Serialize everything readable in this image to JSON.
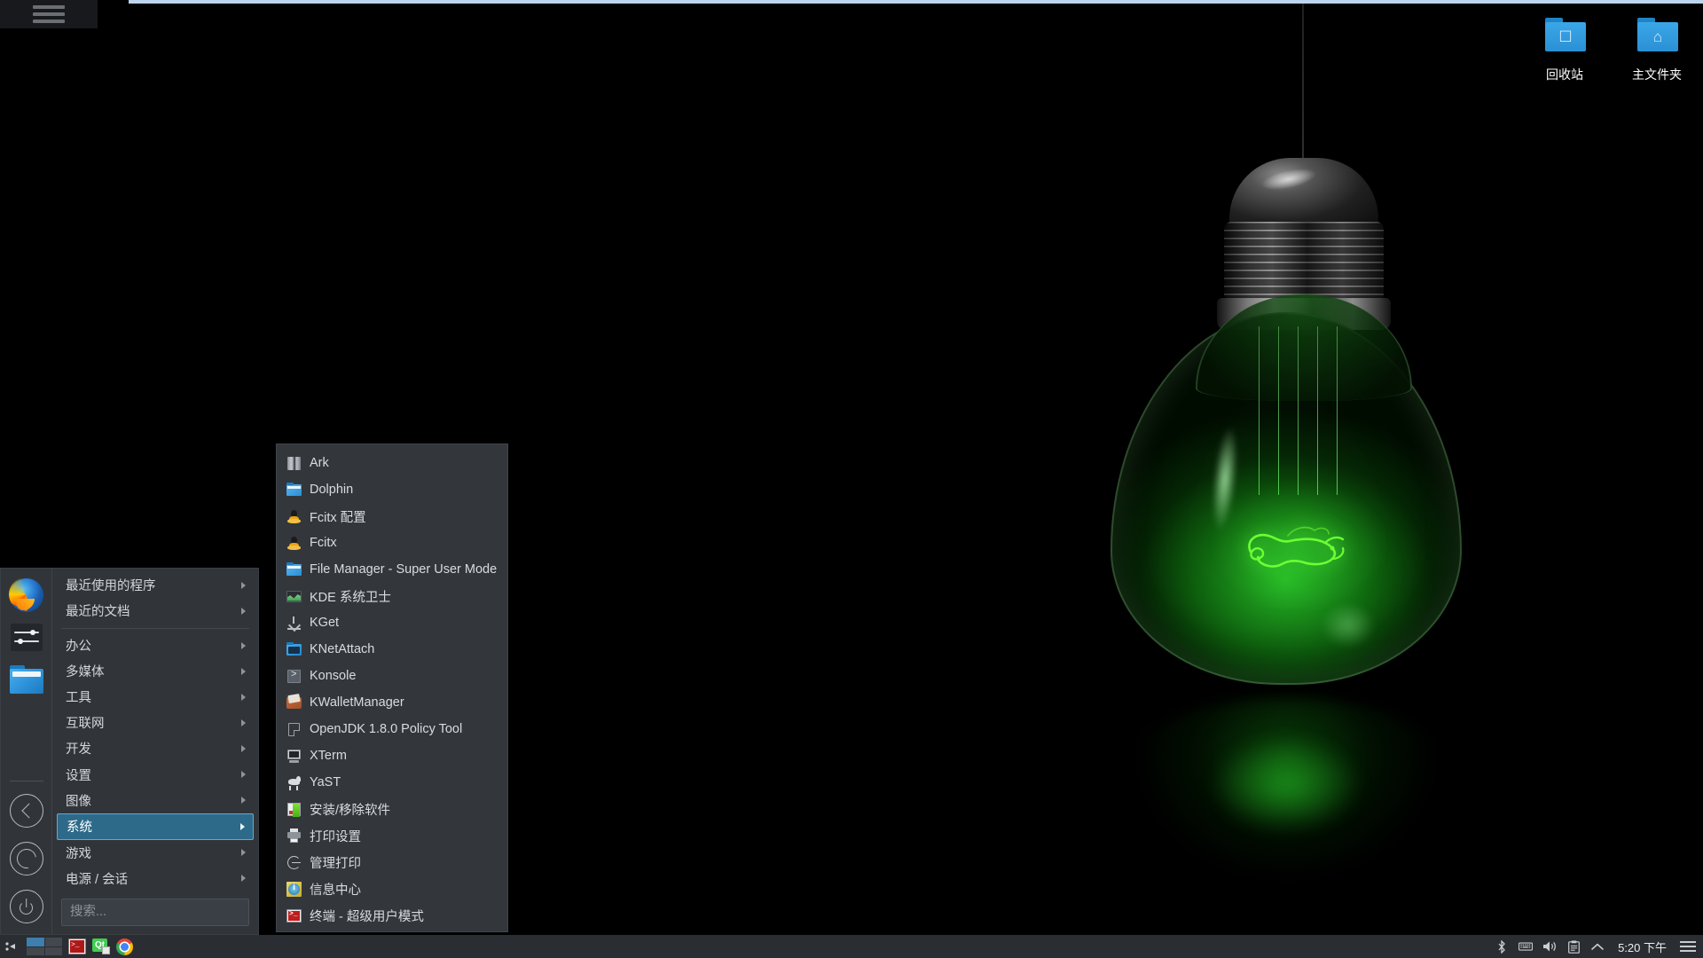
{
  "desktop": {
    "wallpaper_name": "openSUSE green light bulb",
    "icons": [
      {
        "label": "回收站",
        "icon": "trash-folder-icon",
        "glyph": "☐"
      },
      {
        "label": "主文件夹",
        "icon": "home-folder-icon",
        "glyph": "⌂"
      }
    ]
  },
  "topbar": {
    "hamburger_icon": "hamburger-menu-icon",
    "accent_color": "#bcd4ee"
  },
  "kmenu": {
    "side_icons": [
      {
        "name": "firefox-icon"
      },
      {
        "name": "settings-sliders-icon"
      },
      {
        "name": "file-manager-folder-icon"
      }
    ],
    "side_buttons": [
      {
        "name": "back-button",
        "icon": "chevron-left-circle-icon"
      },
      {
        "name": "restart-button",
        "icon": "refresh-circle-icon"
      },
      {
        "name": "power-button",
        "icon": "power-circle-icon"
      }
    ],
    "top_items": [
      {
        "label": "最近使用的程序",
        "has_submenu": true
      },
      {
        "label": "最近的文档",
        "has_submenu": true
      }
    ],
    "category_items": [
      {
        "label": "办公",
        "has_submenu": true,
        "selected": false
      },
      {
        "label": "多媒体",
        "has_submenu": true,
        "selected": false
      },
      {
        "label": "工具",
        "has_submenu": true,
        "selected": false
      },
      {
        "label": "互联网",
        "has_submenu": true,
        "selected": false
      },
      {
        "label": "开发",
        "has_submenu": true,
        "selected": false
      },
      {
        "label": "设置",
        "has_submenu": true,
        "selected": false
      },
      {
        "label": "图像",
        "has_submenu": true,
        "selected": false
      },
      {
        "label": "系统",
        "has_submenu": true,
        "selected": true
      },
      {
        "label": "游戏",
        "has_submenu": true,
        "selected": false
      },
      {
        "label": "电源 / 会话",
        "has_submenu": true,
        "selected": false
      }
    ],
    "search": {
      "value": "",
      "placeholder": "搜索..."
    },
    "selection_color": "#2d6a8a",
    "selection_border_color": "#64a8cf"
  },
  "submenu": {
    "title": "系统",
    "items": [
      {
        "label": "Ark",
        "icon": "ark-archiver-icon"
      },
      {
        "label": "Dolphin",
        "icon": "dolphin-folder-icon"
      },
      {
        "label": "Fcitx 配置",
        "icon": "fcitx-penguin-icon"
      },
      {
        "label": "Fcitx",
        "icon": "fcitx-penguin-icon"
      },
      {
        "label": "File Manager - Super User Mode",
        "icon": "file-manager-folder-icon"
      },
      {
        "label": "KDE 系统卫士",
        "icon": "ksysguard-chart-icon"
      },
      {
        "label": "KGet",
        "icon": "kget-download-icon"
      },
      {
        "label": "KNetAttach",
        "icon": "knetattach-network-folder-icon"
      },
      {
        "label": "Konsole",
        "icon": "konsole-terminal-icon"
      },
      {
        "label": "KWalletManager",
        "icon": "kwallet-icon"
      },
      {
        "label": "OpenJDK 1.8.0 Policy Tool",
        "icon": "document-icon"
      },
      {
        "label": "XTerm",
        "icon": "xterm-monitor-icon"
      },
      {
        "label": "YaST",
        "icon": "yast-chameleon-icon"
      },
      {
        "label": "安装/移除软件",
        "icon": "install-software-icon"
      },
      {
        "label": "打印设置",
        "icon": "printer-icon"
      },
      {
        "label": "管理打印",
        "icon": "cups-printer-admin-icon"
      },
      {
        "label": "信息中心",
        "icon": "info-center-icon"
      },
      {
        "label": "终端 - 超级用户模式",
        "icon": "root-terminal-icon"
      }
    ]
  },
  "taskbar": {
    "left_items": [
      {
        "name": "activities-launcher-icon"
      },
      {
        "name": "pager-widget",
        "active_cell": 0
      },
      {
        "name": "terminal-task-icon"
      },
      {
        "name": "qtcreator-task-icon",
        "text": "Qt"
      },
      {
        "name": "chrome-task-icon"
      }
    ],
    "tray_icons": [
      {
        "name": "bluetooth-icon",
        "glyph": "✶"
      },
      {
        "name": "keyboard-layout-icon",
        "glyph": "⌨"
      },
      {
        "name": "volume-icon",
        "glyph": "🔊"
      },
      {
        "name": "clipboard-icon",
        "glyph": "📋"
      },
      {
        "name": "show-hidden-tray-icon",
        "glyph": "▲"
      }
    ],
    "clock": "5:20 下午",
    "menu_icon": "tray-hamburger-icon",
    "background_color": "#2a2e33"
  }
}
